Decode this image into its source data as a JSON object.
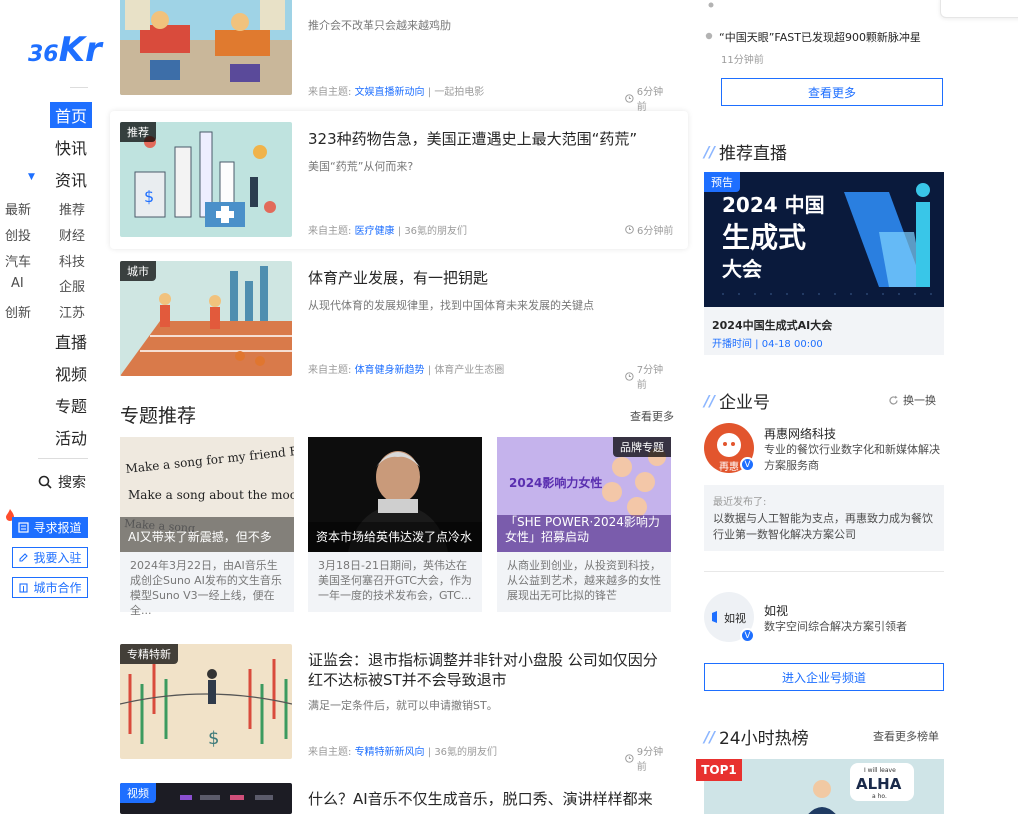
{
  "brand": {
    "logo_text_a": "36",
    "logo_text_b": "Kr"
  },
  "nav": {
    "main": [
      "首页",
      "快讯",
      "资讯",
      "直播",
      "视频",
      "专题",
      "活动"
    ],
    "sub_left": [
      "最新",
      "创投",
      "汽车",
      "AI",
      "创新"
    ],
    "sub_right": [
      "推荐",
      "财经",
      "科技",
      "企服",
      "江苏"
    ],
    "search_label": "搜索",
    "buttons": [
      "寻求报道",
      "我要入驻",
      "城市合作"
    ]
  },
  "articles": [
    {
      "title": "",
      "summary": "推介会不改革只会越来越鸡肋",
      "topic_prefix": "来自主题:",
      "topic": "文娱直播新动向",
      "author": "一起拍电影",
      "time": "6分钟前"
    },
    {
      "badge": "推荐",
      "title": "323种药物告急，美国正遭遇史上最大范围“药荒”",
      "summary": "美国“药荒”从何而来?",
      "topic_prefix": "来自主题:",
      "topic": "医疗健康",
      "author": "36氪的朋友们",
      "time": "6分钟前"
    },
    {
      "badge": "城市",
      "title": "体育产业发展，有一把钥匙",
      "summary": "从现代体育的发展规律里，找到中国体育未来发展的关键点",
      "topic_prefix": "来自主题:",
      "topic": "体育健身新趋势",
      "author": "体育产业生态圈",
      "time": "7分钟前"
    },
    {
      "badge": "专精特新",
      "title": "证监会：退市指标调整并非针对小盘股 公司如仅因分红不达标被ST并不会导致退市",
      "summary": "满足一定条件后，就可以申请撤销ST。",
      "topic_prefix": "来自主题:",
      "topic": "专精特新新风向",
      "author": "36氪的朋友们",
      "time": "9分钟前"
    },
    {
      "badge": "视频",
      "title": "什么？AI音乐不仅生成音乐，脱口秀、演讲样样都来"
    }
  ],
  "special": {
    "title": "专题推荐",
    "more": "查看更多",
    "cards": [
      {
        "caption": "AI又带来了新震撼，但不多",
        "desc": "2024年3月22日，由AI音乐生成创企Suno AI发布的文生音乐模型Suno V3一经上线，便在全...",
        "img_lines": [
          "Make a song for my friend Earl.",
          "Make a song about the moon.",
          "Make a song"
        ]
      },
      {
        "caption": "资本市场给英伟达泼了点冷水",
        "desc": "3月18日-21日期间，英伟达在美国圣何塞召开GTC大会，作为一年一度的技术发布会，GTC..."
      },
      {
        "badge": "品牌专题",
        "caption": "「SHE POWER·2024影响力女性」招募启动",
        "desc": "从商业到创业，从投资到科技，从公益到艺术，越来越多的女性展现出无可比拟的锋芒",
        "img_title": "2024影响力女性"
      }
    ]
  },
  "right": {
    "news": [
      {
        "text": "“中国天眼”FAST已发现超900颗新脉冲星",
        "time": "11分钟前"
      }
    ],
    "news_more": "查看更多",
    "live": {
      "header": "推荐直播",
      "badge": "预告",
      "poster_line1": "2024 中国",
      "poster_line2": "生成式",
      "poster_line3": "大会",
      "event_title": "2024中国生成式AI大会",
      "time_label": "开播时间",
      "time_value": "04-18 00:00"
    },
    "enterprise": {
      "header": "企业号",
      "refresh": "换一换",
      "items": [
        {
          "name": "再惠网络科技",
          "desc": "专业的餐饮行业数字化和新媒体解决方案服务商",
          "avatar_text": "再惠",
          "recent_label": "最近发布了:",
          "recent_text": "以数据与人工智能为支点，再惠致力成为餐饮行业第一数智化解决方案公司"
        },
        {
          "name": "如视",
          "desc": "数字空间综合解决方案引领者",
          "avatar_text": "如视"
        }
      ],
      "channel_button": "进入企业号频道"
    },
    "hot": {
      "header": "24小时热榜",
      "more": "查看更多榜单",
      "top_badge": "TOP1",
      "bubble_line1": "I will leave",
      "bubble_line2": "ALHA",
      "bubble_line3": "a ho."
    }
  },
  "colors": {
    "accent": "#1e6fff",
    "text": "#262626",
    "muted": "#9b9b9b",
    "panel": "#f2f4f7"
  }
}
